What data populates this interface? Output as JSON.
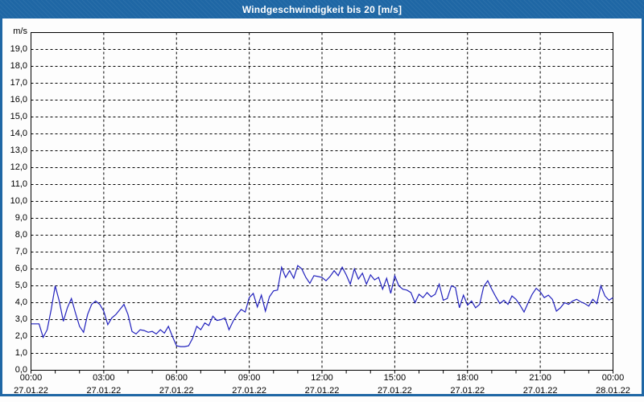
{
  "window": {
    "title": "Windgeschwindigkeit bis 20 [m/s]"
  },
  "colors": {
    "titlebar": "#1f67a5",
    "title_text": "#ffffff",
    "line": "#2121bd",
    "grid": "#000000",
    "frame": "#000000",
    "background": "#fdfdfd"
  },
  "y_axis": {
    "unit_label": "m/s",
    "min": 0,
    "max": 20,
    "tick_step": 1,
    "tick_labels": [
      "0,0",
      "1,0",
      "2,0",
      "3,0",
      "4,0",
      "5,0",
      "6,0",
      "7,0",
      "8,0",
      "9,0",
      "10,0",
      "11,0",
      "12,0",
      "13,0",
      "14,0",
      "15,0",
      "16,0",
      "17,0",
      "18,0",
      "19,0"
    ]
  },
  "x_axis": {
    "major_tick_hours": [
      0,
      3,
      6,
      9,
      12,
      15,
      18,
      21,
      24
    ],
    "time_labels": [
      "00:00",
      "03:00",
      "06:00",
      "09:00",
      "12:00",
      "15:00",
      "18:00",
      "21:00",
      "00:00"
    ],
    "date_labels": [
      "27.01.22",
      "27.01.22",
      "27.01.22",
      "27.01.22",
      "27.01.22",
      "27.01.22",
      "27.01.22",
      "27.01.22",
      "28.01.22"
    ],
    "minor_tick_step_hours": 1,
    "span_hours": 24
  },
  "chart_data": {
    "type": "line",
    "title": "Windgeschwindigkeit bis 20 [m/s]",
    "ylabel": "m/s",
    "ylim": [
      0,
      20
    ],
    "xlim_hours": [
      0,
      24
    ],
    "grid": "dashed",
    "legend": "none",
    "sample_interval_minutes": 10,
    "series": [
      {
        "name": "Windgeschwindigkeit",
        "color": "#2121bd",
        "values": [
          2.75,
          2.75,
          2.75,
          1.95,
          2.4,
          3.6,
          5.0,
          4.1,
          2.9,
          3.7,
          4.25,
          3.4,
          2.6,
          2.25,
          3.3,
          3.9,
          4.1,
          3.9,
          3.5,
          2.7,
          3.1,
          3.3,
          3.6,
          3.9,
          3.3,
          2.3,
          2.15,
          2.4,
          2.35,
          2.25,
          2.3,
          2.15,
          2.4,
          2.2,
          2.6,
          2.0,
          1.45,
          1.4,
          1.4,
          1.45,
          1.9,
          2.6,
          2.4,
          2.8,
          2.65,
          3.2,
          2.95,
          3.0,
          3.1,
          2.4,
          2.9,
          3.3,
          3.6,
          3.45,
          4.3,
          4.55,
          3.75,
          4.45,
          3.5,
          4.35,
          4.7,
          4.75,
          6.1,
          5.5,
          5.9,
          5.45,
          6.2,
          6.0,
          5.5,
          5.15,
          5.6,
          5.55,
          5.5,
          5.3,
          5.55,
          5.9,
          5.6,
          6.1,
          5.65,
          5.1,
          6.0,
          5.4,
          5.75,
          5.1,
          5.65,
          5.35,
          5.5,
          4.8,
          5.45,
          4.55,
          5.6,
          5.0,
          4.8,
          4.75,
          4.6,
          4.0,
          4.5,
          4.3,
          4.6,
          4.35,
          4.5,
          5.1,
          4.15,
          4.25,
          5.0,
          4.9,
          3.7,
          4.45,
          3.85,
          4.1,
          3.7,
          3.9,
          4.95,
          5.3,
          4.8,
          4.35,
          3.95,
          4.15,
          3.9,
          4.4,
          4.2,
          3.85,
          3.45,
          4.0,
          4.5,
          4.85,
          4.65,
          4.3,
          4.45,
          4.2,
          3.5,
          3.7,
          4.0,
          3.9,
          4.1,
          4.2,
          4.05,
          3.95,
          3.8,
          4.2,
          3.95,
          5.0,
          4.4,
          4.15,
          4.3
        ]
      }
    ]
  }
}
